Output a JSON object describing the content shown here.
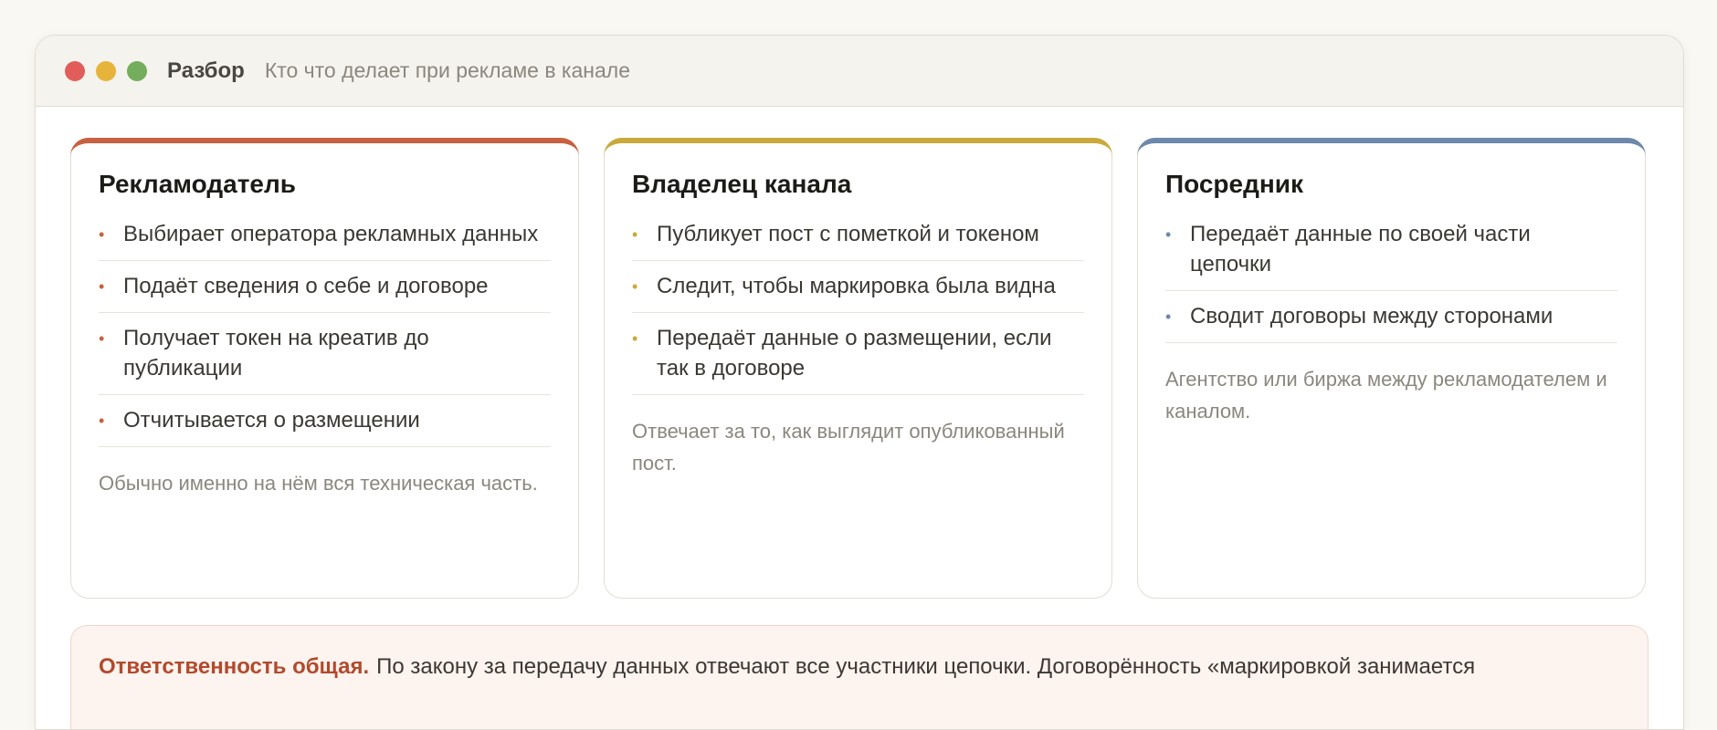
{
  "window": {
    "title": "Разбор",
    "subtitle": "Кто что делает при рекламе в канале"
  },
  "cards": [
    {
      "title": "Рекламодатель",
      "accent": "#c9603f",
      "items": [
        "Выбирает оператора рекламных данных",
        "Подаёт сведения о себе и договоре",
        "Получает токен на креатив до публикации",
        "Отчитывается о размещении"
      ],
      "note": "Обычно именно на нём вся техническая часть."
    },
    {
      "title": "Владелец канала",
      "accent": "#c9a93a",
      "items": [
        "Публикует пост с пометкой и токеном",
        "Следит, чтобы маркировка была видна",
        "Передаёт данные о размещении, если так в договоре"
      ],
      "note": "Отвечает за то, как выглядит опубликованный пост."
    },
    {
      "title": "Посредник",
      "accent": "#6c88aa",
      "items": [
        "Передаёт данные по своей части цепочки",
        "Сводит договоры между сторонами"
      ],
      "note": "Агентство или биржа между рекламодателем и каналом."
    }
  ],
  "callout": {
    "lead": "Ответственность общая.",
    "text": "По закону за передачу данных отвечают все участники цепочки. Договорённость «маркировкой занимается"
  },
  "bullet_glyph": "•"
}
